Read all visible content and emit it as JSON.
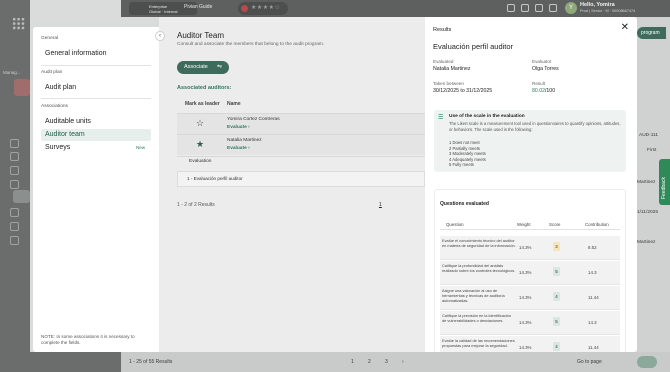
{
  "background": {
    "environment": {
      "name": "Enterprise",
      "badge": "Global · Internal"
    },
    "guide_label": "Pivian Guide",
    "rating_stars": "★★★★☆",
    "user": {
      "initial": "Y",
      "name": "Hello, Yomira",
      "sub": "Prod | Senior · M · 00008667474"
    },
    "manage_label": "Manag...",
    "program_button": "program",
    "right_texts": [
      "AUD-111",
      "First",
      "Martinez",
      "1/11/2025",
      "Martinez"
    ],
    "feedback_label": "Feedback",
    "results_count": "1 - 25 of 55 Results",
    "pages": [
      "1",
      "2",
      "3",
      "›"
    ],
    "go_to_page": "Go to page"
  },
  "left_panel": {
    "sections": [
      {
        "title": "General",
        "items": [
          {
            "label": "General information"
          }
        ]
      },
      {
        "title": "Audit plan",
        "items": [
          {
            "label": "Audit plan"
          }
        ]
      },
      {
        "title": "Associations",
        "items": [
          {
            "label": "Auditable units"
          },
          {
            "label": "Auditor team",
            "active": true
          },
          {
            "label": "Surveys",
            "badge": "New"
          }
        ]
      }
    ],
    "note": "NOTE: In some associations it is necessary to complete the fields."
  },
  "middle_panel": {
    "title": "Auditor Team",
    "subtitle": "Consult and associate the members that belong to the audit program.",
    "associate_button": "Associate",
    "associated_label": "Associated auditors:",
    "columns": {
      "leader": "Mark as leader",
      "name": "Name"
    },
    "rows": [
      {
        "name": "Yomira Cortez Contreras",
        "link": "Evaluate ›",
        "leader": false
      },
      {
        "name": "Natalia Martinez",
        "link": "Evaluate ›",
        "leader": true
      }
    ],
    "evaluation_header": "Evaluation",
    "evaluation_row": "1 - Evaluación perfil auditor",
    "results": "1 - 2 of 2 Results",
    "page": "1"
  },
  "results_panel": {
    "header": "Results",
    "title": "Evaluación perfil auditor",
    "evaluated_label": "Evaluated",
    "evaluated_value": "Natalia Martinez",
    "evaluator_label": "Evaluator",
    "evaluator_value": "Olga Torres",
    "period_label": "Taken between",
    "period_value": "30/12/2025 to 31/12/2025",
    "result_label": "Result",
    "result_value": "80.02",
    "result_max": "/100",
    "scale": {
      "title": "Use of the scale in the evaluation",
      "description": "The Likert scale is a measurement tool used in questionnaires to quantify opinions, attitudes, or behaviors. The scale used is the following:",
      "levels": [
        "1 Does not meet",
        "2 Partially meets",
        "3 Moderately meets",
        "4 Adequately meets",
        "5 Fully meets"
      ]
    },
    "questions_title": "Questions evaluated",
    "columns": {
      "question": "Question",
      "weight": "Weight",
      "score": "Score",
      "contribution": "Contribution"
    },
    "questions": [
      {
        "q": "Evalúe el conocimiento técnico del auditor en materia de seguridad de la información.",
        "w": "14.3%",
        "s": "3",
        "c": "8.52"
      },
      {
        "q": "Califique la profundidad del análisis realizado sobre los controles tecnológicos.",
        "w": "14.3%",
        "s": "5",
        "c": "14.3"
      },
      {
        "q": "Asigne una valoración al uso de herramientas y técnicas de auditoría automatizadas.",
        "w": "14.3%",
        "s": "4",
        "c": "11.44"
      },
      {
        "q": "Califique la precisión en la identificación de vulnerabilidades o desviaciones.",
        "w": "14.3%",
        "s": "5",
        "c": "14.3"
      },
      {
        "q": "Evalúe la calidad de las recomendaciones propuestas para mejorar la seguridad.",
        "w": "14.3%",
        "s": "4",
        "c": "11.44"
      }
    ]
  }
}
